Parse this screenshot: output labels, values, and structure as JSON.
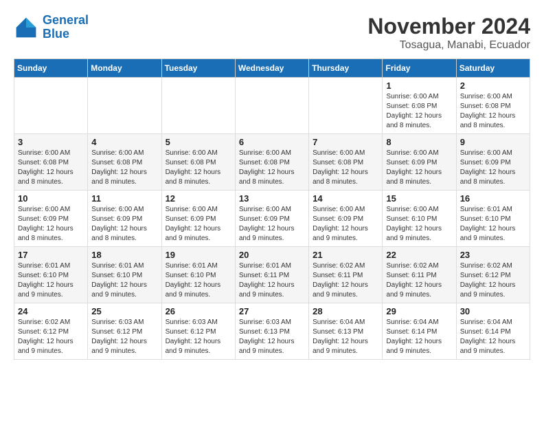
{
  "header": {
    "logo_line1": "General",
    "logo_line2": "Blue",
    "month_year": "November 2024",
    "location": "Tosagua, Manabi, Ecuador"
  },
  "days_of_week": [
    "Sunday",
    "Monday",
    "Tuesday",
    "Wednesday",
    "Thursday",
    "Friday",
    "Saturday"
  ],
  "weeks": [
    [
      {
        "day": "",
        "info": ""
      },
      {
        "day": "",
        "info": ""
      },
      {
        "day": "",
        "info": ""
      },
      {
        "day": "",
        "info": ""
      },
      {
        "day": "",
        "info": ""
      },
      {
        "day": "1",
        "info": "Sunrise: 6:00 AM\nSunset: 6:08 PM\nDaylight: 12 hours and 8 minutes."
      },
      {
        "day": "2",
        "info": "Sunrise: 6:00 AM\nSunset: 6:08 PM\nDaylight: 12 hours and 8 minutes."
      }
    ],
    [
      {
        "day": "3",
        "info": "Sunrise: 6:00 AM\nSunset: 6:08 PM\nDaylight: 12 hours and 8 minutes."
      },
      {
        "day": "4",
        "info": "Sunrise: 6:00 AM\nSunset: 6:08 PM\nDaylight: 12 hours and 8 minutes."
      },
      {
        "day": "5",
        "info": "Sunrise: 6:00 AM\nSunset: 6:08 PM\nDaylight: 12 hours and 8 minutes."
      },
      {
        "day": "6",
        "info": "Sunrise: 6:00 AM\nSunset: 6:08 PM\nDaylight: 12 hours and 8 minutes."
      },
      {
        "day": "7",
        "info": "Sunrise: 6:00 AM\nSunset: 6:08 PM\nDaylight: 12 hours and 8 minutes."
      },
      {
        "day": "8",
        "info": "Sunrise: 6:00 AM\nSunset: 6:09 PM\nDaylight: 12 hours and 8 minutes."
      },
      {
        "day": "9",
        "info": "Sunrise: 6:00 AM\nSunset: 6:09 PM\nDaylight: 12 hours and 8 minutes."
      }
    ],
    [
      {
        "day": "10",
        "info": "Sunrise: 6:00 AM\nSunset: 6:09 PM\nDaylight: 12 hours and 8 minutes."
      },
      {
        "day": "11",
        "info": "Sunrise: 6:00 AM\nSunset: 6:09 PM\nDaylight: 12 hours and 8 minutes."
      },
      {
        "day": "12",
        "info": "Sunrise: 6:00 AM\nSunset: 6:09 PM\nDaylight: 12 hours and 9 minutes."
      },
      {
        "day": "13",
        "info": "Sunrise: 6:00 AM\nSunset: 6:09 PM\nDaylight: 12 hours and 9 minutes."
      },
      {
        "day": "14",
        "info": "Sunrise: 6:00 AM\nSunset: 6:09 PM\nDaylight: 12 hours and 9 minutes."
      },
      {
        "day": "15",
        "info": "Sunrise: 6:00 AM\nSunset: 6:10 PM\nDaylight: 12 hours and 9 minutes."
      },
      {
        "day": "16",
        "info": "Sunrise: 6:01 AM\nSunset: 6:10 PM\nDaylight: 12 hours and 9 minutes."
      }
    ],
    [
      {
        "day": "17",
        "info": "Sunrise: 6:01 AM\nSunset: 6:10 PM\nDaylight: 12 hours and 9 minutes."
      },
      {
        "day": "18",
        "info": "Sunrise: 6:01 AM\nSunset: 6:10 PM\nDaylight: 12 hours and 9 minutes."
      },
      {
        "day": "19",
        "info": "Sunrise: 6:01 AM\nSunset: 6:10 PM\nDaylight: 12 hours and 9 minutes."
      },
      {
        "day": "20",
        "info": "Sunrise: 6:01 AM\nSunset: 6:11 PM\nDaylight: 12 hours and 9 minutes."
      },
      {
        "day": "21",
        "info": "Sunrise: 6:02 AM\nSunset: 6:11 PM\nDaylight: 12 hours and 9 minutes."
      },
      {
        "day": "22",
        "info": "Sunrise: 6:02 AM\nSunset: 6:11 PM\nDaylight: 12 hours and 9 minutes."
      },
      {
        "day": "23",
        "info": "Sunrise: 6:02 AM\nSunset: 6:12 PM\nDaylight: 12 hours and 9 minutes."
      }
    ],
    [
      {
        "day": "24",
        "info": "Sunrise: 6:02 AM\nSunset: 6:12 PM\nDaylight: 12 hours and 9 minutes."
      },
      {
        "day": "25",
        "info": "Sunrise: 6:03 AM\nSunset: 6:12 PM\nDaylight: 12 hours and 9 minutes."
      },
      {
        "day": "26",
        "info": "Sunrise: 6:03 AM\nSunset: 6:12 PM\nDaylight: 12 hours and 9 minutes."
      },
      {
        "day": "27",
        "info": "Sunrise: 6:03 AM\nSunset: 6:13 PM\nDaylight: 12 hours and 9 minutes."
      },
      {
        "day": "28",
        "info": "Sunrise: 6:04 AM\nSunset: 6:13 PM\nDaylight: 12 hours and 9 minutes."
      },
      {
        "day": "29",
        "info": "Sunrise: 6:04 AM\nSunset: 6:14 PM\nDaylight: 12 hours and 9 minutes."
      },
      {
        "day": "30",
        "info": "Sunrise: 6:04 AM\nSunset: 6:14 PM\nDaylight: 12 hours and 9 minutes."
      }
    ]
  ]
}
